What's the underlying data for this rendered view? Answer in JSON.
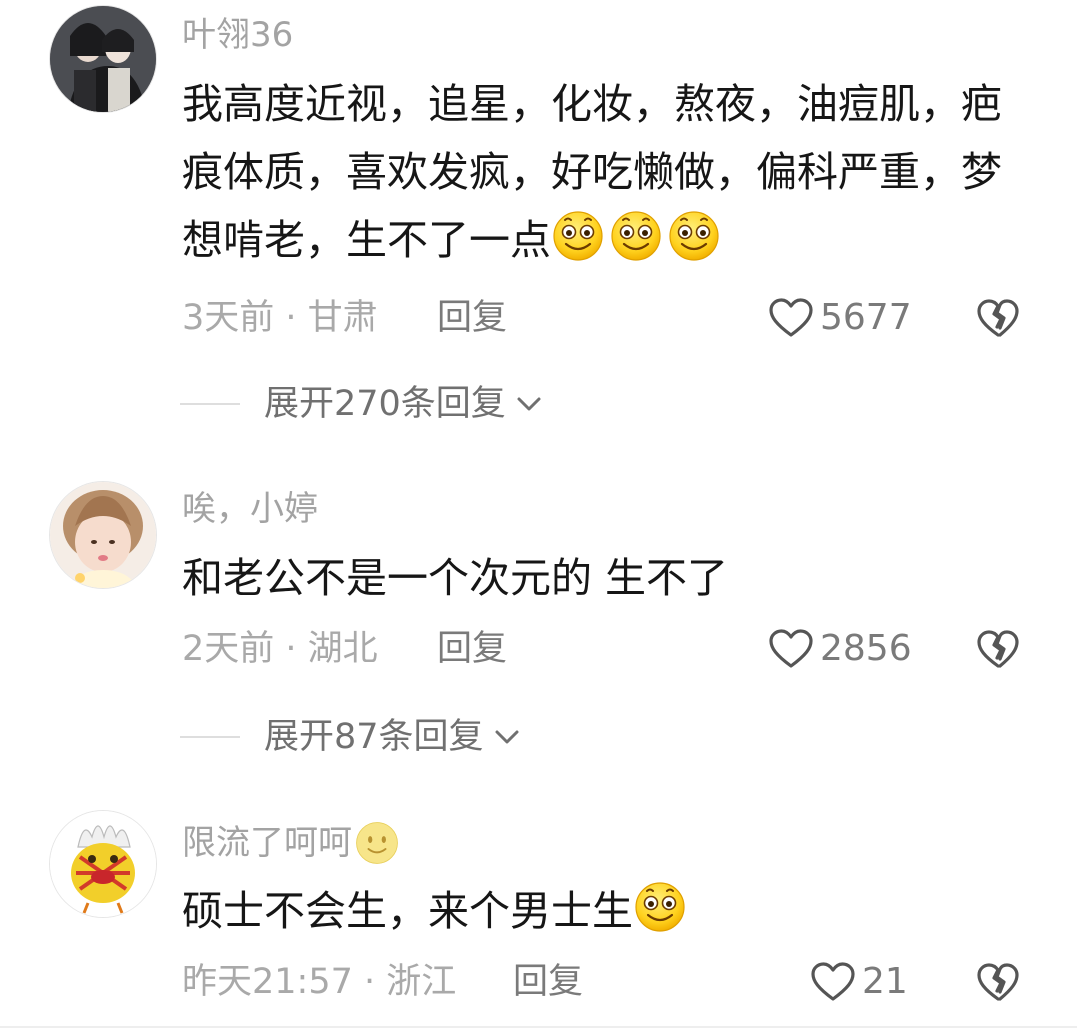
{
  "comments": [
    {
      "username": "叶翎36",
      "text": "我高度近视，追星，化妆，熬夜，油痘肌，疤痕体质，喜欢发疯，好吃懒做，偏科严重，梦想啃老，生不了一点",
      "emojis_after_text": [
        "laughing-face-icon",
        "laughing-face-icon",
        "laughing-face-icon"
      ],
      "time_location": "3天前 · 甘肃",
      "reply_label": "回复",
      "likes": "5677",
      "expand_label": "展开270条回复"
    },
    {
      "username": "唉，小婷",
      "text": "和老公不是一个次元的 生不了",
      "time_location": "2天前 · 湖北",
      "reply_label": "回复",
      "likes": "2856",
      "expand_label": "展开87条回复"
    },
    {
      "username": "限流了呵呵",
      "username_emoji": "smile-face-icon",
      "text": "硕士不会生，来个男士生",
      "emojis_after_text": [
        "laughing-face-icon"
      ],
      "time_location": "昨天21:57 · 浙江",
      "reply_label": "回复",
      "likes": "21"
    }
  ],
  "colors": {
    "username": "#a3a3a3",
    "body_text": "#161616",
    "meta": "#a9a9a9",
    "emoji_yellow": "#ffd21f"
  }
}
